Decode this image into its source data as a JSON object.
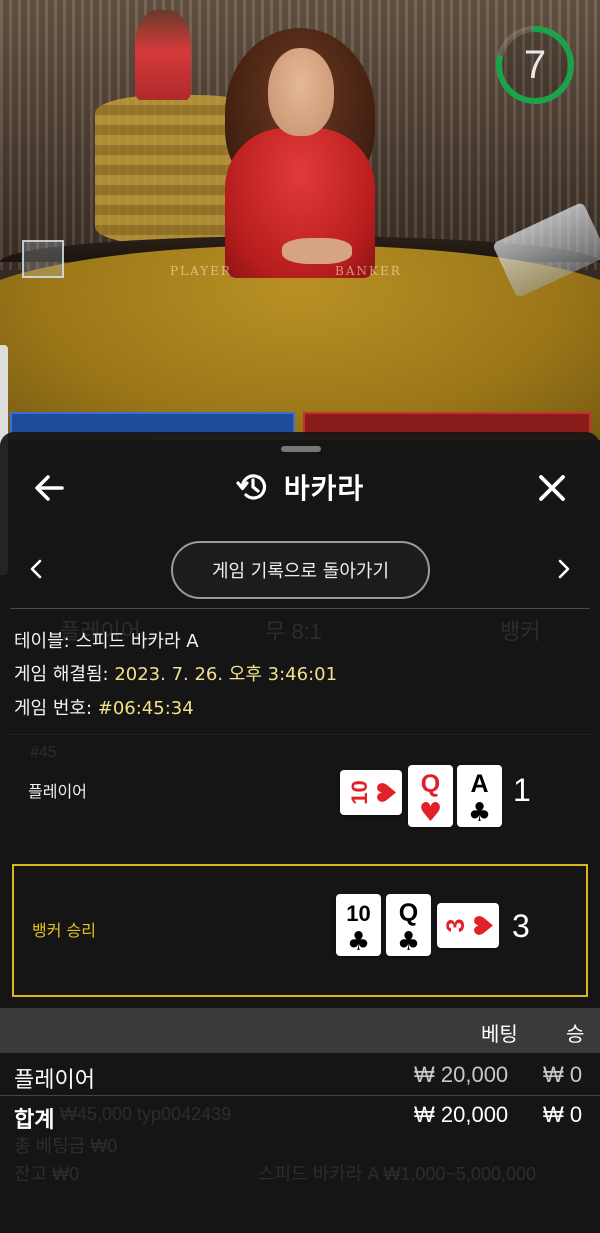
{
  "video": {
    "felt_player": "PLAYER",
    "felt_banker": "BANKER",
    "countdown": "7",
    "countdown_fraction": 0.78,
    "timer_color": "#1aa34a"
  },
  "header": {
    "title": "바카라",
    "back_icon": "arrow-left-icon",
    "history_icon": "history-icon",
    "close_icon": "close-icon"
  },
  "nav": {
    "pill_label": "게임 기록으로 돌아가기",
    "prev_icon": "chevron-left-icon",
    "next_icon": "chevron-right-icon"
  },
  "details": {
    "table_label": "테이블: ",
    "table_value": "스피드 바카라 A",
    "resolved_label": "게임 해결됨: ",
    "resolved_value": "2023. 7. 26. 오후 3:46:01",
    "number_label": "게임 번호: ",
    "number_value": "#06:45:34"
  },
  "result": {
    "player_label": "플레이어",
    "player_score": "1",
    "player_cards": [
      {
        "rank": "10",
        "suit": "♥",
        "color": "#e1202a",
        "sideways": true
      },
      {
        "rank": "Q",
        "suit": "♥",
        "color": "#e1202a",
        "sideways": false
      },
      {
        "rank": "A",
        "suit": "♣",
        "color": "#000000",
        "sideways": false
      }
    ],
    "banker_label": "뱅커 승리",
    "banker_label_color": "#e6c21a",
    "banker_score": "3",
    "banker_cards": [
      {
        "rank": "10",
        "suit": "♣",
        "color": "#000000",
        "sideways": false
      },
      {
        "rank": "Q",
        "suit": "♣",
        "color": "#000000",
        "sideways": false
      },
      {
        "rank": "3",
        "suit": "♥",
        "color": "#e1202a",
        "sideways": true
      }
    ]
  },
  "bets": {
    "col_bet": "베팅",
    "col_win": "승",
    "row_label": "플레이어",
    "row_bet": "₩ 20,000",
    "row_win": "₩ 0",
    "total_label": "합계",
    "total_bet": "₩ 20,000",
    "total_win": "₩ 0"
  },
  "ghost": {
    "tab_player": "플레이어",
    "tab_tie": "무 8:1",
    "tab_banker": "뱅커",
    "stat_p": "#45",
    "footer_balance": "₩45,000 typ0042439",
    "footer_bet": "총 베팅금 ₩0",
    "footer_balance2": "잔고 ₩0",
    "footer_limits": "스피드 바카라 A ₩1,000~5,000,000"
  }
}
